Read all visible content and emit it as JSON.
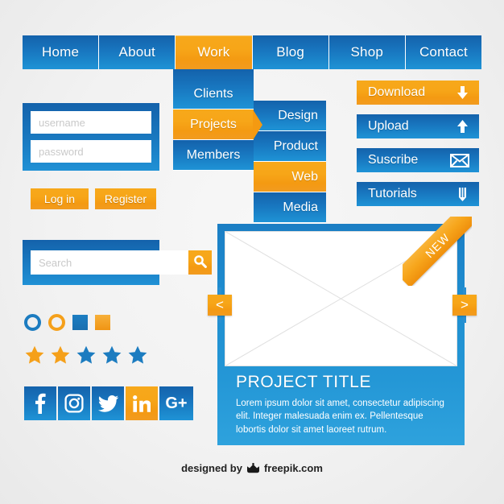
{
  "nav": {
    "items": [
      {
        "label": "Home",
        "active": false
      },
      {
        "label": "About",
        "active": false
      },
      {
        "label": "Work",
        "active": true
      },
      {
        "label": "Blog",
        "active": false
      },
      {
        "label": "Shop",
        "active": false
      },
      {
        "label": "Contact",
        "active": false
      }
    ]
  },
  "submenu_primary": {
    "items": [
      {
        "label": "Clients",
        "active": false
      },
      {
        "label": "Projects",
        "active": true
      },
      {
        "label": "Members",
        "active": false
      }
    ]
  },
  "submenu_secondary": {
    "items": [
      {
        "label": "Design",
        "active": false
      },
      {
        "label": "Product",
        "active": false
      },
      {
        "label": "Web",
        "active": true
      },
      {
        "label": "Media",
        "active": false
      }
    ]
  },
  "login": {
    "username_placeholder": "username",
    "username_value": "",
    "password_placeholder": "password",
    "password_value": "",
    "login_label": "Log in",
    "register_label": "Register"
  },
  "actions": {
    "items": [
      {
        "label": "Download",
        "icon": "arrow-down-icon",
        "active": true
      },
      {
        "label": "Upload",
        "icon": "arrow-up-icon",
        "active": false
      },
      {
        "label": "Suscribe",
        "icon": "envelope-icon",
        "active": false
      },
      {
        "label": "Tutorials",
        "icon": "pencil-icon",
        "active": false
      }
    ]
  },
  "search": {
    "placeholder": "Search",
    "value": "",
    "button_icon": "search-icon"
  },
  "controls": {
    "items": [
      {
        "name": "radio-blue",
        "type": "ring",
        "color": "#1c7cc0"
      },
      {
        "name": "radio-orange",
        "type": "ring",
        "color": "#f5a01a"
      },
      {
        "name": "checkbox-blue",
        "type": "square",
        "color": "#1c7ec2"
      },
      {
        "name": "checkbox-orange",
        "type": "square",
        "color": "#f09514"
      }
    ]
  },
  "rating": {
    "max": 5,
    "value": 2,
    "filled_color": "#f5a01a",
    "empty_color": "#1c7cc0"
  },
  "social": {
    "items": [
      {
        "name": "facebook-icon",
        "label": "Facebook",
        "active": false
      },
      {
        "name": "instagram-icon",
        "label": "Instagram",
        "active": false
      },
      {
        "name": "twitter-icon",
        "label": "Twitter",
        "active": false
      },
      {
        "name": "linkedin-icon",
        "label": "LinkedIn",
        "active": true
      },
      {
        "name": "googleplus-icon",
        "label": "G+",
        "active": false
      }
    ]
  },
  "card": {
    "ribbon_label": "NEW",
    "title": "PROJECT TITLE",
    "description": "Lorem ipsum dolor sit amet, consectetur adipiscing elit. Integer malesuada enim ex. Pellentesque lobortis dolor sit amet laoreet rutrum.",
    "prev_label": "<",
    "next_label": ">"
  },
  "footer": {
    "prefix": "designed by",
    "brand": "freepik.com"
  },
  "colors": {
    "blue_dark": "#1462ab",
    "blue_light": "#2091d5",
    "orange": "#f5a01a",
    "background": "#f2f2f2"
  }
}
